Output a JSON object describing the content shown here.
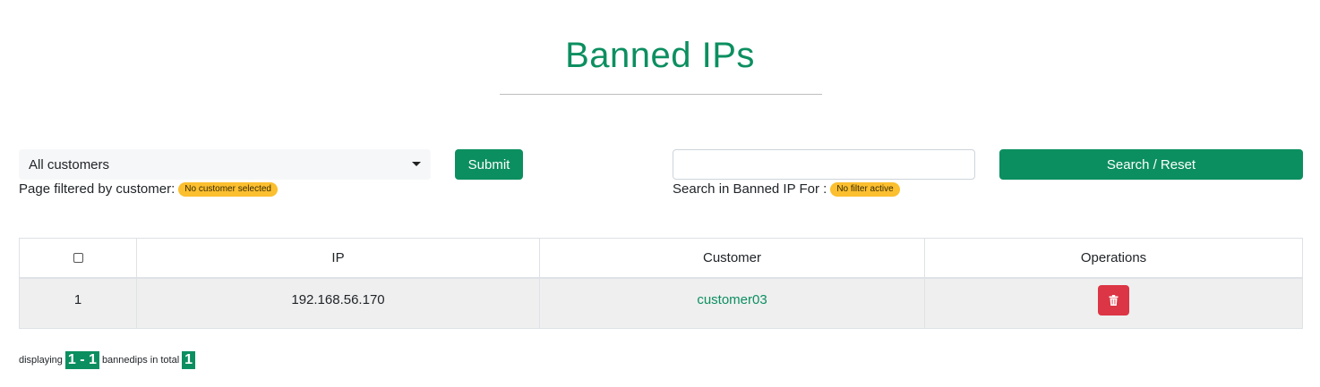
{
  "page": {
    "title": "Banned IPs"
  },
  "filters": {
    "customer_select": {
      "selected": "All customers"
    },
    "submit_label": "Submit",
    "customer_filter_label": "Page filtered by customer:",
    "customer_filter_badge": "No customer selected",
    "search_input": {
      "value": "",
      "placeholder": ""
    },
    "search_reset_label": "Search / Reset",
    "search_filter_label": "Search in Banned IP For :",
    "search_filter_badge": "No filter active"
  },
  "table": {
    "headers": {
      "ip": "IP",
      "customer": "Customer",
      "operations": "Operations"
    },
    "rows": [
      {
        "index": "1",
        "ip": "192.168.56.170",
        "customer": "customer03"
      }
    ]
  },
  "footer": {
    "displaying_label": "displaying",
    "range": "1 - 1",
    "total_label": "bannedips in total",
    "total": "1"
  },
  "colors": {
    "accent": "#0c8f60",
    "danger": "#dc3545",
    "badge": "#fbbf2f"
  }
}
